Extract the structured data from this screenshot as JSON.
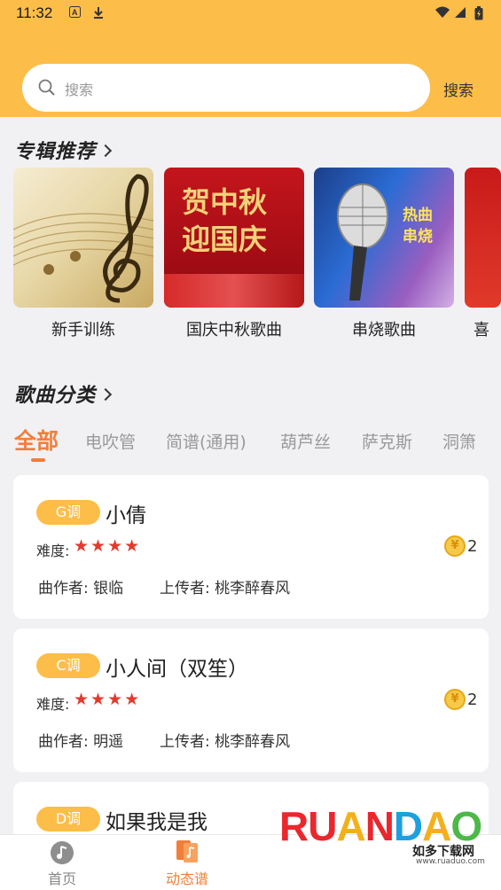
{
  "status_bar": {
    "time": "11:32"
  },
  "search": {
    "placeholder": "搜索",
    "button_label": "搜索"
  },
  "albums": {
    "title": "专辑推荐",
    "items": [
      {
        "label": "新手训练"
      },
      {
        "label": "国庆中秋歌曲",
        "art_text": "贺中秋\n迎国庆"
      },
      {
        "label": "串烧歌曲",
        "art_text": "热曲\n串烧"
      },
      {
        "label": "喜"
      }
    ]
  },
  "categories": {
    "title": "歌曲分类",
    "tabs": [
      "全部",
      "电吹管",
      "简谱(通用)",
      "葫芦丝",
      "萨克斯",
      "洞箫"
    ],
    "active_index": 0
  },
  "songs": [
    {
      "key": "G调",
      "title": "小倩",
      "difficulty_label": "难度:",
      "stars": "★★★★",
      "coins": "2",
      "composer": "曲作者: 银临",
      "uploader": "上传者: 桃李醉春风"
    },
    {
      "key": "C调",
      "title": "小人间（双笙）",
      "difficulty_label": "难度:",
      "stars": "★★★★",
      "coins": "2",
      "composer": "曲作者: 明遥",
      "uploader": "上传者: 桃李醉春风"
    },
    {
      "key": "D调",
      "title": "如果我是我"
    }
  ],
  "bottom_nav": {
    "items": [
      {
        "label": "首页"
      },
      {
        "label": "动态谱"
      }
    ],
    "active_index": 1
  },
  "watermark": {
    "text": "RUANDAO",
    "sub": "如多下载网",
    "url": "www.ruaduo.com"
  },
  "colors": {
    "primary": "#fdbd49",
    "accent": "#f07f3a",
    "star": "#e23b2e"
  }
}
